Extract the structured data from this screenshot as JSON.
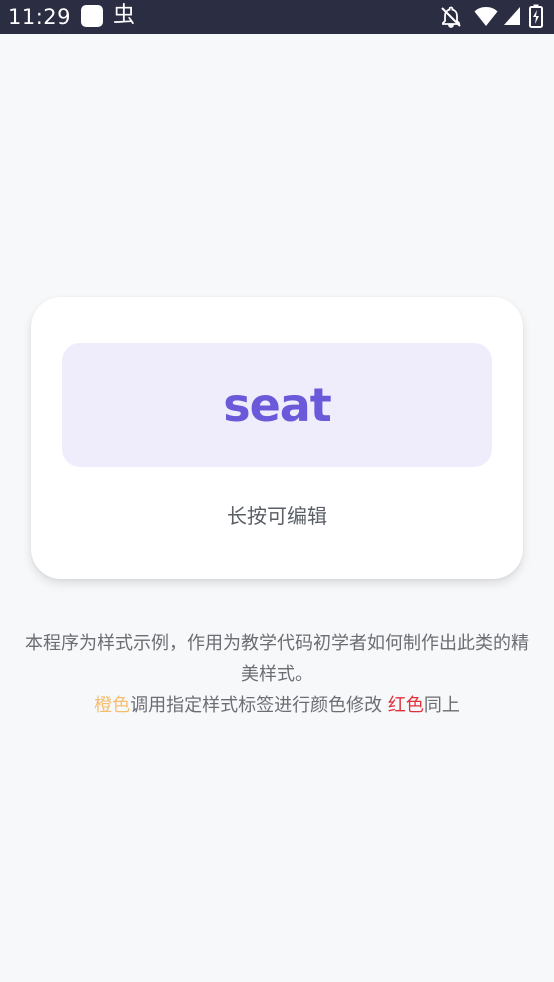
{
  "status_bar": {
    "time": "11:29",
    "bug_glyph": "虫",
    "icons": [
      "notification-square-icon",
      "bug-icon",
      "notifications-off-icon",
      "wifi-icon",
      "signal-icon",
      "battery-charging-icon"
    ]
  },
  "card": {
    "word": "seat",
    "hint": "长按可编辑"
  },
  "description": {
    "line1": "本程序为样式示例，作用为教学代码初学者如何制作出此类的精美样式。",
    "orange_label": "橙色",
    "middle_text": "调用指定样式标签进行颜色修改 ",
    "red_label": "红色",
    "end_text": "同上"
  },
  "colors": {
    "status_bar": "#2b2d42",
    "background": "#f7f8fa",
    "accent": "#6a5ad9",
    "accent_bg": "#efecfb",
    "orange": "#f4be6e",
    "red": "#e0313a"
  }
}
